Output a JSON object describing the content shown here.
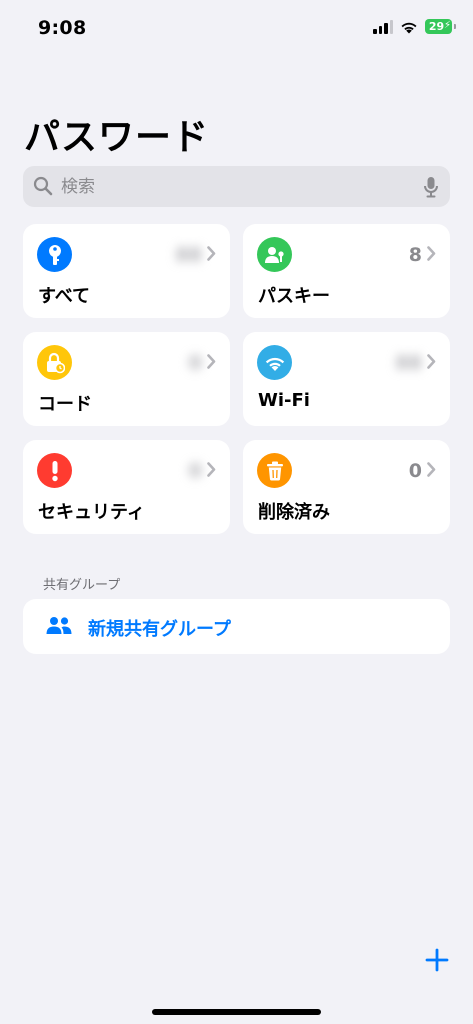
{
  "status_bar": {
    "time": "9:08",
    "battery_level": "29",
    "icons": [
      "cellular-signal-icon",
      "wifi-icon",
      "battery-charging-icon"
    ]
  },
  "title": "パスワード",
  "search": {
    "placeholder": "検索"
  },
  "categories": [
    {
      "label": "すべて",
      "count": "88",
      "count_obscured": true,
      "icon": "key-icon",
      "color": "#007aff"
    },
    {
      "label": "パスキー",
      "count": "8",
      "count_obscured": false,
      "icon": "person-key-icon",
      "color": "#34c759"
    },
    {
      "label": "コード",
      "count": "0",
      "count_obscured": true,
      "icon": "lock-clock-icon",
      "color": "#ffc60a"
    },
    {
      "label": "Wi-Fi",
      "count": "88",
      "count_obscured": true,
      "icon": "wifi-icon",
      "color": "#32ade6"
    },
    {
      "label": "セキュリティ",
      "count": "0",
      "count_obscured": true,
      "icon": "exclamation-icon",
      "color": "#ff3b30"
    },
    {
      "label": "削除済み",
      "count": "0",
      "count_obscured": false,
      "icon": "trash-icon",
      "color": "#ff9500"
    }
  ],
  "shared_groups": {
    "header": "共有グループ",
    "new_group_label": "新規共有グループ"
  },
  "colors": {
    "accent": "#007aff",
    "background": "#f2f2f7",
    "card": "#ffffff"
  }
}
